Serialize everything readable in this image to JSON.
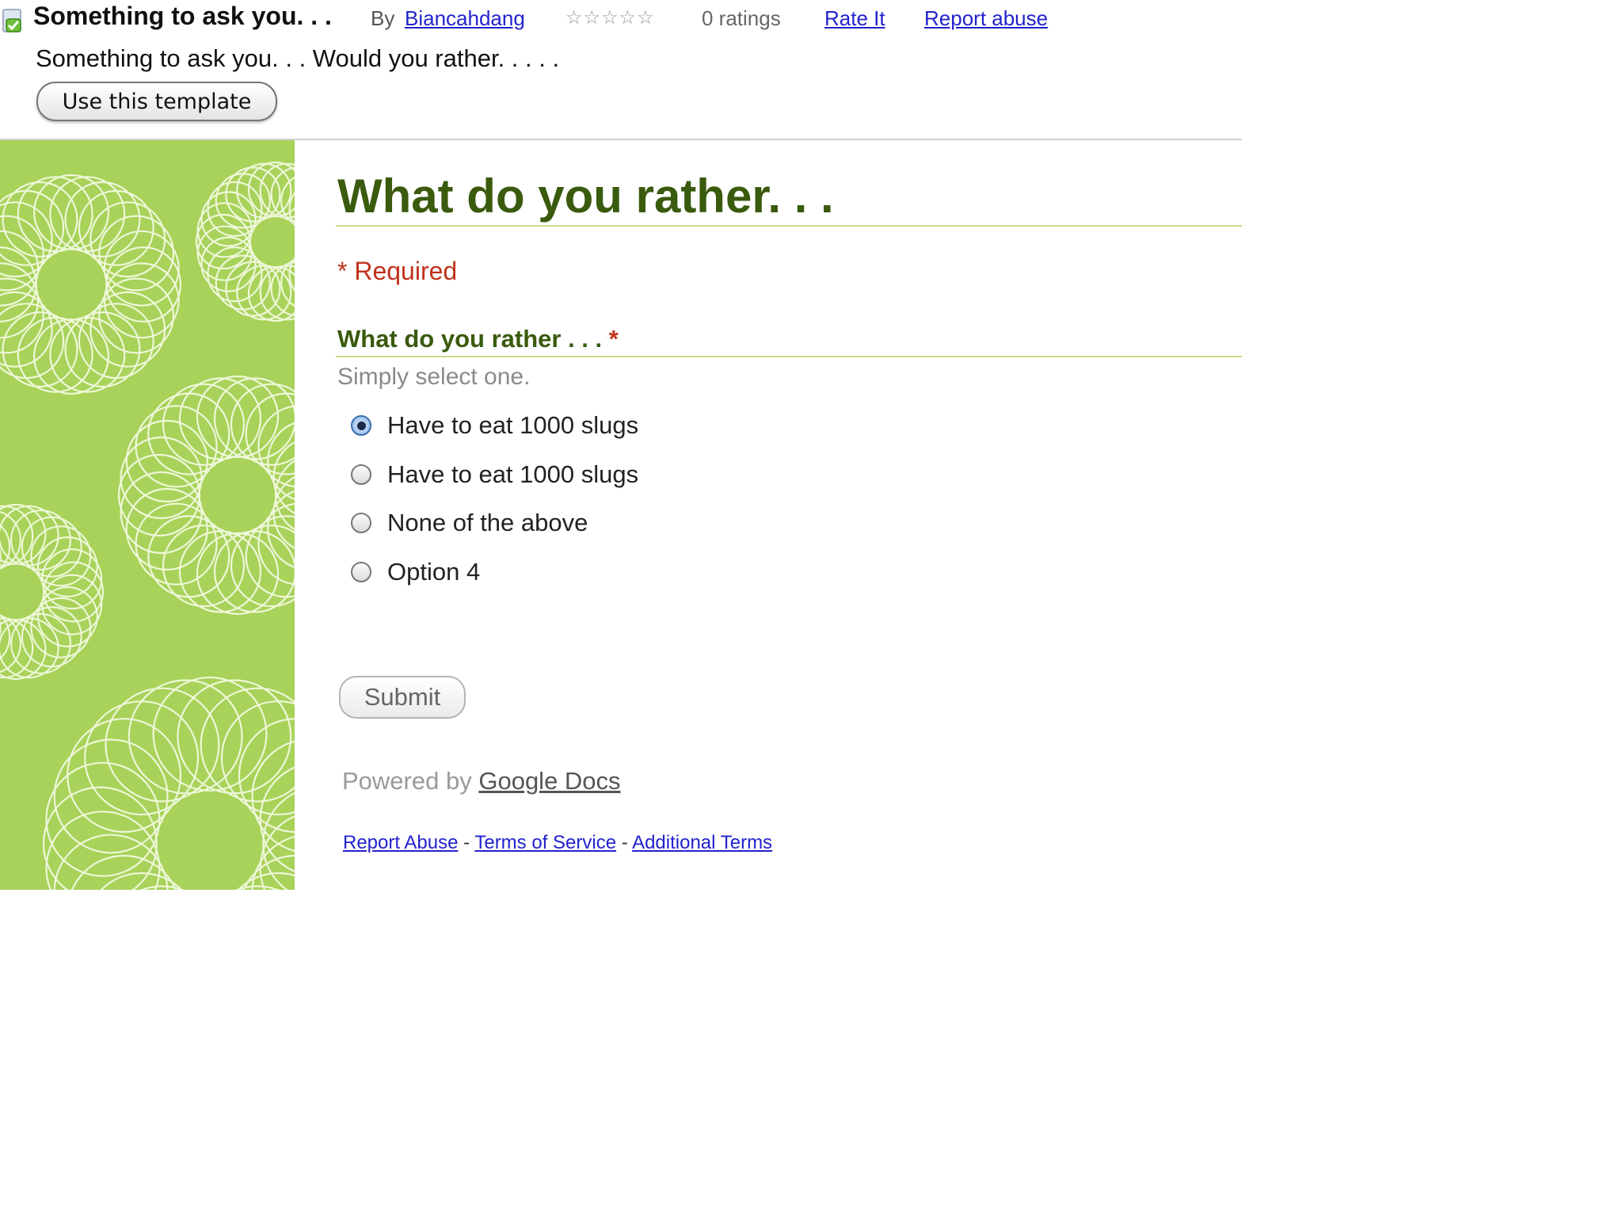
{
  "template_header": {
    "title": "Something to ask you. . .",
    "by_label": "By",
    "author": "Biancahdang",
    "stars_icon": "☆☆☆☆☆",
    "rating": 0,
    "ratings_label": "0 ratings",
    "rate_it_label": "Rate It",
    "report_abuse_label": "Report abuse",
    "description": "Something to ask you. . . Would you rather. . . . .",
    "use_template_label": "Use this template"
  },
  "side_panel": {
    "pattern_icon": "spirograph-pattern",
    "background_color": "#a8d25a",
    "pattern_color": "#eef7d8"
  },
  "form": {
    "title": "What do you rather. . .",
    "required_note": "* Required",
    "question": {
      "label": "What do you rather . . .",
      "required_marker": "*",
      "help_text": "Simply select one.",
      "options": [
        {
          "label": "Have to eat 1000 slugs",
          "selected": true
        },
        {
          "label": "Have to eat 1000 slugs",
          "selected": false
        },
        {
          "label": "None of the above",
          "selected": false
        },
        {
          "label": "Option 4",
          "selected": false
        }
      ]
    },
    "submit_label": "Submit"
  },
  "footer": {
    "powered_by": "Powered by",
    "google_docs_link": "Google Docs",
    "separator": "-",
    "links": [
      "Report Abuse",
      "Terms of Service",
      "Additional Terms"
    ]
  },
  "colors": {
    "title_green": "#3a5a0e",
    "required_red": "#c0321a",
    "link_blue": "#2222cc",
    "rule_green": "#c6d98a"
  }
}
